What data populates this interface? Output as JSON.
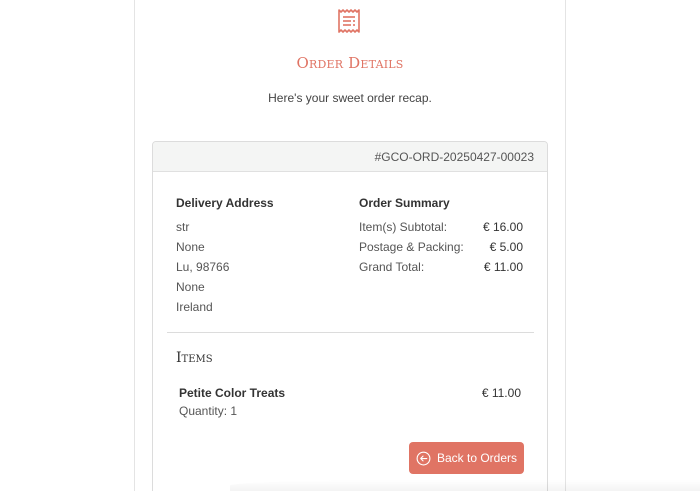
{
  "header": {
    "title": "Order Details",
    "subtitle": "Here's your sweet order recap.",
    "icon": "receipt-icon"
  },
  "order": {
    "number": "#GCO-ORD-20250427-00023"
  },
  "delivery": {
    "title": "Delivery Address",
    "lines": [
      "str",
      "None",
      "Lu, 98766",
      "None",
      "Ireland"
    ]
  },
  "summary": {
    "title": "Order Summary",
    "rows": [
      {
        "label": "Item(s) Subtotal:",
        "value": "€ 16.00"
      },
      {
        "label": "Postage & Packing:",
        "value": "€ 5.00"
      },
      {
        "label": "Grand Total:",
        "value": "€ 11.00"
      }
    ]
  },
  "items": {
    "title": "Items",
    "list": [
      {
        "name": "Petite Color Treats",
        "quantity": "Quantity: 1",
        "price": "€ 11.00"
      }
    ]
  },
  "actions": {
    "back_label": "Back to Orders",
    "back_icon": "arrow-left-circle-icon"
  },
  "colors": {
    "accent": "#e07464",
    "header_bg": "#f4f5f4"
  }
}
